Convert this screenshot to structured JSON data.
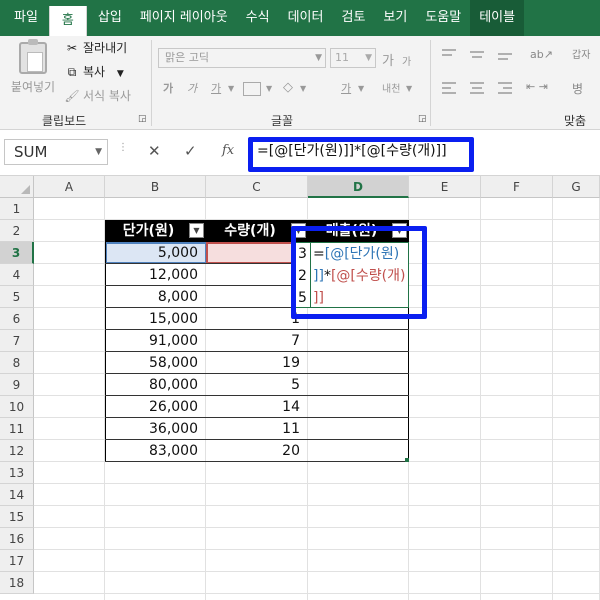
{
  "ribbon_tabs": [
    "파일",
    "홈",
    "삽입",
    "페이지 레이아웃",
    "수식",
    "데이터",
    "검토",
    "보기",
    "도움말",
    "테이블"
  ],
  "clipboard": {
    "paste_label": "붙여넣기",
    "cut_label": "잘라내기",
    "copy_label": "복사",
    "format_painter_label": "서식 복사",
    "group_label": "클립보드"
  },
  "font": {
    "font_name": "맑은 고딕",
    "font_size": "11",
    "grow_label": "가",
    "shrink_label": "가",
    "bold_label": "가",
    "italic_label": "가",
    "underline_label": "가",
    "phonetic_label": "내천",
    "group_label": "글꼴"
  },
  "alignment": {
    "wrap_label": "갑자",
    "merge_label": "병",
    "group_label": "맞춤"
  },
  "formula_bar": {
    "name_box": "SUM",
    "cancel_icon": "✕",
    "enter_icon": "✓",
    "fx_label": "fx",
    "formula": "=[@[단가(원)]]*[@[수량(개)]]"
  },
  "columns": [
    "A",
    "B",
    "C",
    "D",
    "E",
    "F",
    "G"
  ],
  "rows": [
    "1",
    "2",
    "3",
    "4",
    "5",
    "6",
    "7",
    "8",
    "9",
    "10",
    "11",
    "12",
    "13",
    "14",
    "15",
    "16",
    "17",
    "18"
  ],
  "selected_cell": {
    "column": "D",
    "row": "3"
  },
  "table": {
    "headers": [
      "단가(원)",
      "수량(개)",
      "매출(원)"
    ],
    "filter_icon": "▼",
    "unit_price": [
      "5,000",
      "12,000",
      "8,000",
      "15,000",
      "91,000",
      "58,000",
      "80,000",
      "26,000",
      "36,000",
      "83,000"
    ],
    "quantity": [
      "3",
      "2",
      "5",
      "1",
      "7",
      "19",
      "5",
      "14",
      "11",
      "20"
    ]
  },
  "in_cell_edit": {
    "line1": {
      "eq": "=",
      "ref": "[@[단가(원)"
    },
    "line2": {
      "close": "]]",
      "op": "*",
      "ref": "[@[수량(개)"
    },
    "line3": {
      "close": "]]"
    }
  }
}
